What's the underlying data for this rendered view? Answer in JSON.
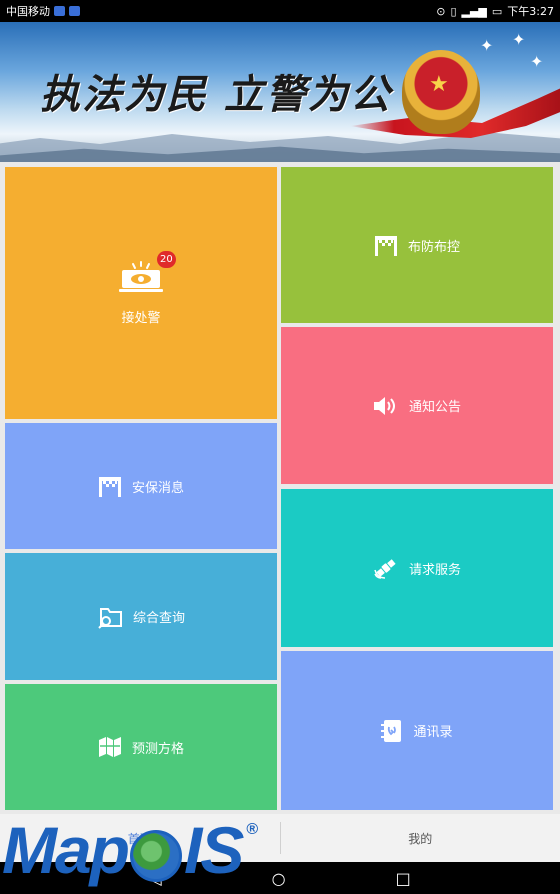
{
  "status_bar": {
    "carrier": "中国移动",
    "time": "下午3:27"
  },
  "banner": {
    "slogan": "执法为民 立警为公"
  },
  "tiles": [
    {
      "id": "jiechujing",
      "label": "接处警",
      "icon": "eye-monitor-icon",
      "color": "#f5ae30",
      "badge": "20"
    },
    {
      "id": "bufangbukong",
      "label": "布防布控",
      "icon": "gate-icon",
      "color": "#97c13c"
    },
    {
      "id": "tongzhigonggao",
      "label": "通知公告",
      "icon": "speaker-icon",
      "color": "#f96e81"
    },
    {
      "id": "anbaoxiaoxi",
      "label": "安保消息",
      "icon": "gate-icon",
      "color": "#7fa4f8"
    },
    {
      "id": "qingqiufuwu",
      "label": "请求服务",
      "icon": "satellite-icon",
      "color": "#1bcbc4"
    },
    {
      "id": "zonghechaxun",
      "label": "综合查询",
      "icon": "folder-search-icon",
      "color": "#47afd8"
    },
    {
      "id": "tongxunlu",
      "label": "通讯录",
      "icon": "contacts-icon",
      "color": "#7fa4f8"
    },
    {
      "id": "yuceFangge",
      "label": "预测方格",
      "icon": "map-icon",
      "color": "#4dc97b"
    }
  ],
  "tabbar": {
    "home": "首页",
    "mine": "我的"
  },
  "watermark": {
    "brand_a": "Map",
    "brand_b": "IS",
    "reg": "®"
  }
}
